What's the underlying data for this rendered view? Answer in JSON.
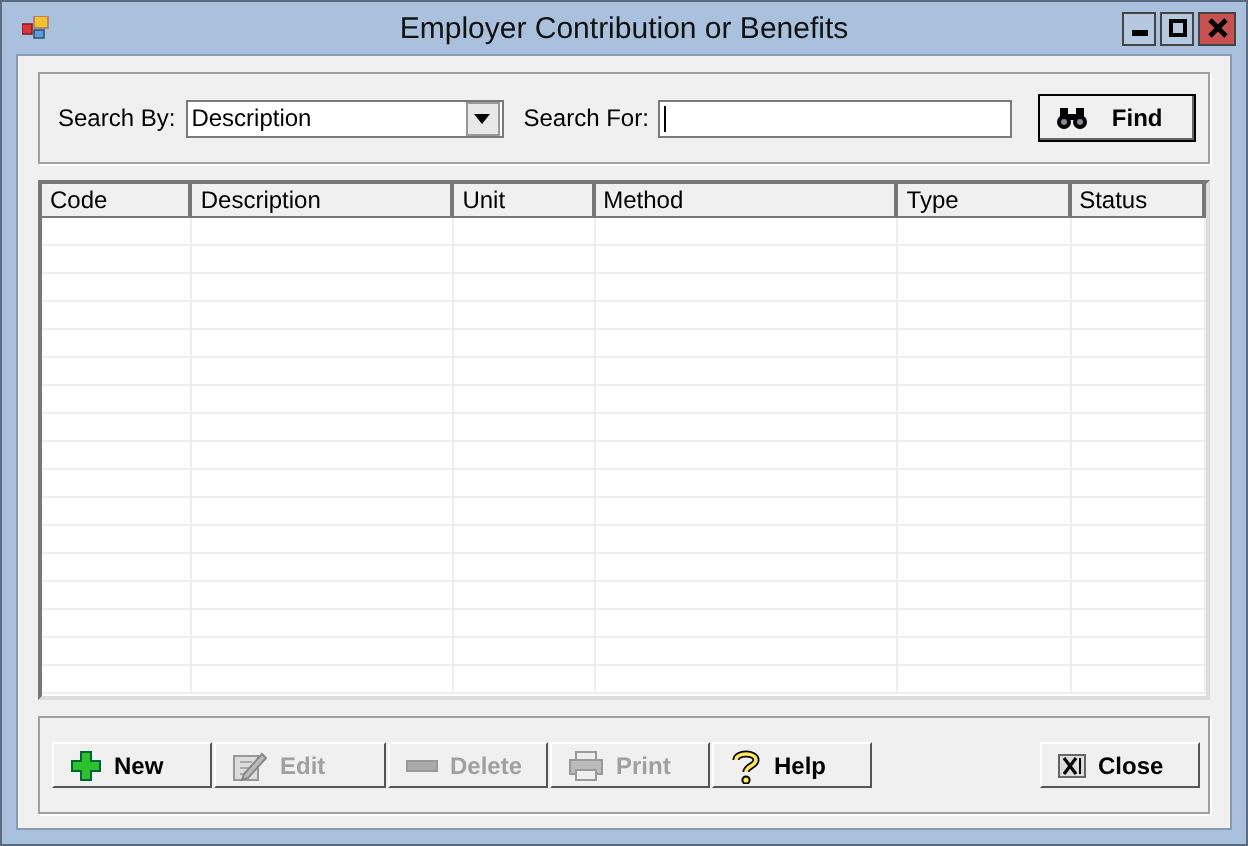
{
  "window": {
    "title": "Employer Contribution or Benefits"
  },
  "search": {
    "search_by_label": "Search By:",
    "search_by_value": "Description",
    "search_for_label": "Search For:",
    "find_button": "Find"
  },
  "table": {
    "columns": [
      "Code",
      "Description",
      "Unit",
      "Method",
      "Type",
      "Status"
    ]
  },
  "buttons": [
    {
      "kind": "new",
      "label": "New",
      "disabled": false
    },
    {
      "kind": "edit",
      "label": "Edit",
      "disabled": true
    },
    {
      "kind": "delete",
      "label": "Delete",
      "disabled": true
    },
    {
      "kind": "print",
      "label": "Print",
      "disabled": true
    },
    {
      "kind": "help",
      "label": "Help",
      "disabled": false
    }
  ],
  "close_button": {
    "label": "Close"
  }
}
